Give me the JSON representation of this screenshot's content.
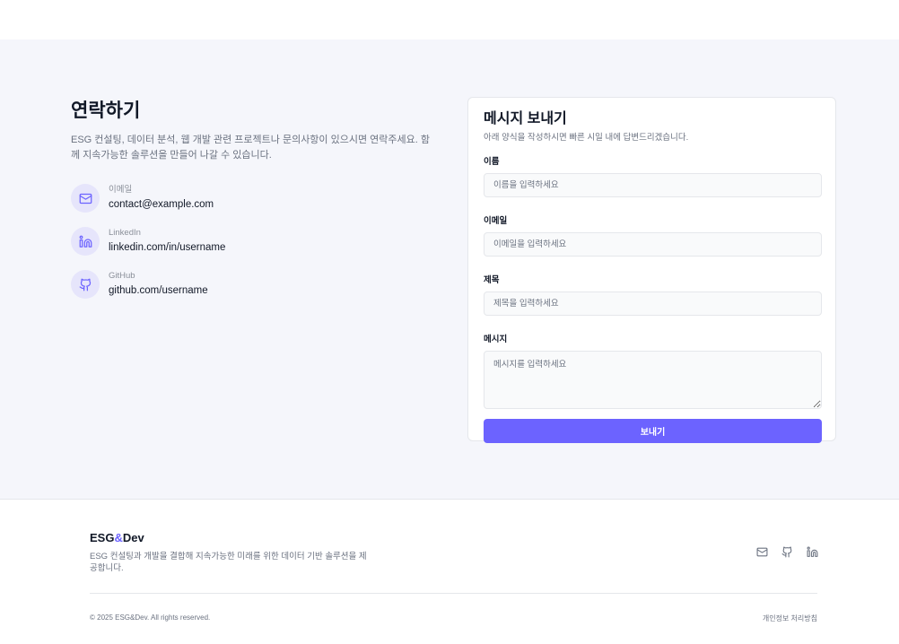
{
  "contact": {
    "title": "연락하기",
    "description": "ESG 컨설팅, 데이터 분석, 웹 개발 관련 프로젝트나 문의사항이 있으시면 연락주세요. 함께 지속가능한 솔루션을 만들어 나갈 수 있습니다.",
    "items": [
      {
        "icon": "mail-icon",
        "label": "이메일",
        "value": "contact@example.com"
      },
      {
        "icon": "linkedin-icon",
        "label": "LinkedIn",
        "value": "linkedin.com/in/username"
      },
      {
        "icon": "github-icon",
        "label": "GitHub",
        "value": "github.com/username"
      }
    ]
  },
  "form": {
    "title": "메시지 보내기",
    "subtitle": "아래 양식을 작성하시면 빠른 시일 내에 답변드리겠습니다.",
    "name_label": "이름",
    "name_placeholder": "이름을 입력하세요",
    "email_label": "이메일",
    "email_placeholder": "이메일을 입력하세요",
    "subject_label": "제목",
    "subject_placeholder": "제목을 입력하세요",
    "message_label": "메시지",
    "message_placeholder": "메시지를 입력하세요",
    "submit_label": "보내기"
  },
  "footer": {
    "brand_prefix": "ESG",
    "brand_amp": "&",
    "brand_suffix": "Dev",
    "description": "ESG 컨설팅과 개발을 결합해 지속가능한 미래를 위한 데이터 기반 솔루션을 제공합니다.",
    "icons": [
      "mail-icon",
      "github-icon",
      "linkedin-icon"
    ],
    "copyright": "© 2025 ESG&Dev. All rights reserved.",
    "privacy": "개인정보 처리방침"
  },
  "colors": {
    "accent": "#6c63ff",
    "section_bg": "#f5f6fb",
    "icon_circle": "#e6e5fb"
  }
}
